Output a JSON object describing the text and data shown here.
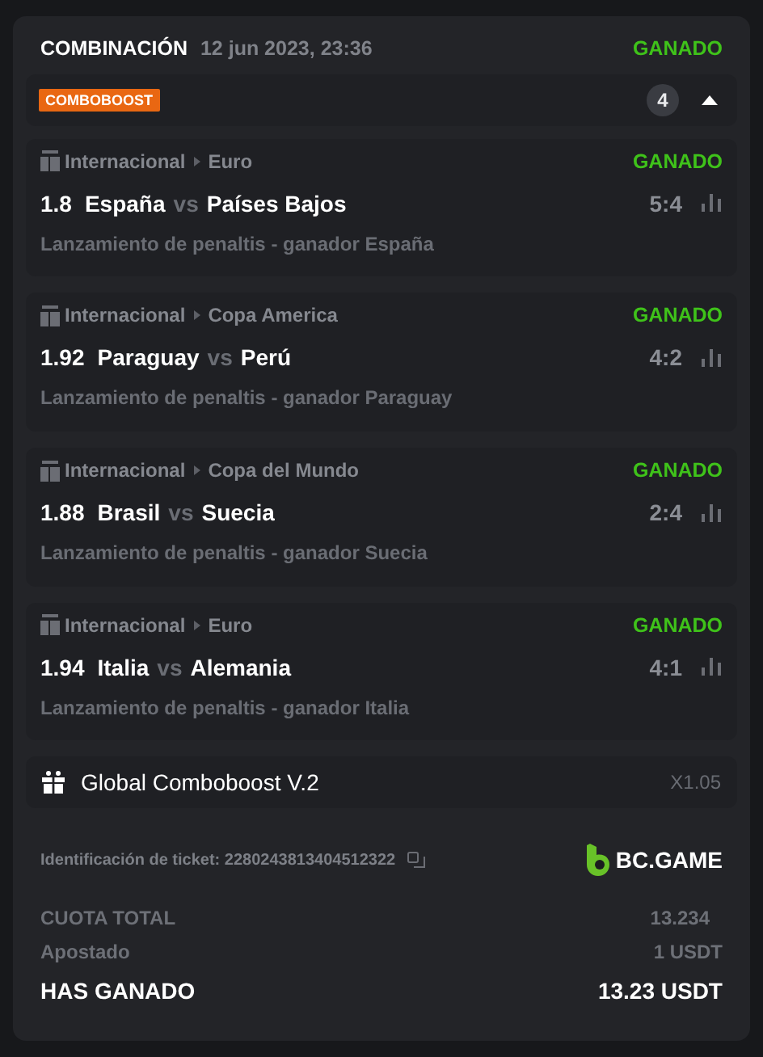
{
  "header": {
    "title": "COMBINACIÓN",
    "date": "12 jun 2023, 23:36",
    "status": "GANADO"
  },
  "boost_bar": {
    "badge": "COMBOBOOST",
    "count": "4",
    "expanded": true
  },
  "selections": [
    {
      "category": "Internacional",
      "league": "Euro",
      "status": "GANADO",
      "odds": "1.8",
      "home": "España",
      "vs": "vs",
      "away": "Países Bajos",
      "score": "5:4",
      "market": "Lanzamiento de penaltis - ganador España"
    },
    {
      "category": "Internacional",
      "league": "Copa America",
      "status": "GANADO",
      "odds": "1.92",
      "home": "Paraguay",
      "vs": "vs",
      "away": "Perú",
      "score": "4:2",
      "market": "Lanzamiento de penaltis - ganador Paraguay"
    },
    {
      "category": "Internacional",
      "league": "Copa del Mundo",
      "status": "GANADO",
      "odds": "1.88",
      "home": "Brasil",
      "vs": "vs",
      "away": "Suecia",
      "score": "2:4",
      "market": "Lanzamiento de penaltis - ganador Suecia"
    },
    {
      "category": "Internacional",
      "league": "Euro",
      "status": "GANADO",
      "odds": "1.94",
      "home": "Italia",
      "vs": "vs",
      "away": "Alemania",
      "score": "4:1",
      "market": "Lanzamiento de penaltis - ganador Italia"
    }
  ],
  "global_boost": {
    "label": "Global Comboboost V.2",
    "multiplier": "X1.05"
  },
  "ticket": {
    "text": "Identificación de ticket: 2280243813404512322",
    "brand": "BC.GAME"
  },
  "totals": [
    {
      "kind": "odds",
      "label": "CUOTA TOTAL",
      "value": "13.234"
    },
    {
      "kind": "stake",
      "label": "Apostado",
      "value": "1 USDT"
    },
    {
      "kind": "win",
      "label": "HAS GANADO",
      "value": "13.23 USDT"
    }
  ]
}
